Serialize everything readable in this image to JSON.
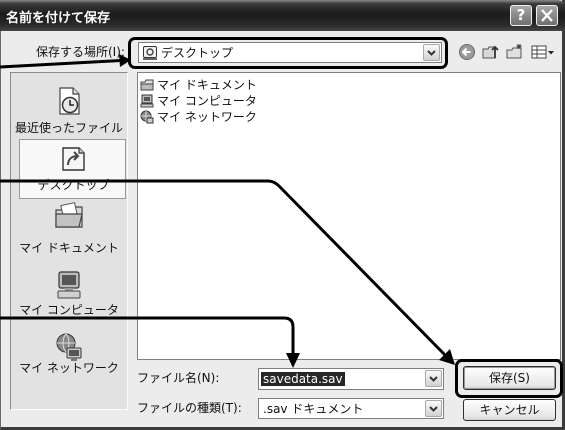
{
  "window": {
    "title": "名前を付けて保存",
    "help_label": "?",
    "close_icon": "close-icon"
  },
  "location": {
    "label": "保存する場所(I):",
    "value": "デスクトップ",
    "icon": "desktop-icon"
  },
  "toolbar": {
    "icons": [
      "back-icon",
      "up-folder-icon",
      "new-folder-icon",
      "views-menu-icon"
    ]
  },
  "places": [
    {
      "label": "最近使ったファイル",
      "icon": "recent-documents-icon"
    },
    {
      "label": "デスクトップ",
      "icon": "desktop-icon"
    },
    {
      "label": "マイ ドキュメント",
      "icon": "my-documents-icon"
    },
    {
      "label": "マイ コンピュータ",
      "icon": "my-computer-icon"
    },
    {
      "label": "マイ ネットワーク",
      "icon": "my-network-icon"
    }
  ],
  "files": [
    {
      "name": "マイ ドキュメント",
      "icon": "my-documents-icon"
    },
    {
      "name": "マイ コンピュータ",
      "icon": "my-computer-icon"
    },
    {
      "name": "マイ ネットワーク",
      "icon": "my-network-icon"
    }
  ],
  "file_name": {
    "label": "ファイル名(N):",
    "value": "savedata.sav"
  },
  "file_type": {
    "label": "ファイルの種類(T):",
    "value": ".sav ドキュメント"
  },
  "buttons": {
    "save": "保存(S)",
    "cancel": "キャンセル"
  },
  "colors": {
    "title_bar": "#1b1b1b",
    "selection": "#262626",
    "annotation": "#000000"
  }
}
